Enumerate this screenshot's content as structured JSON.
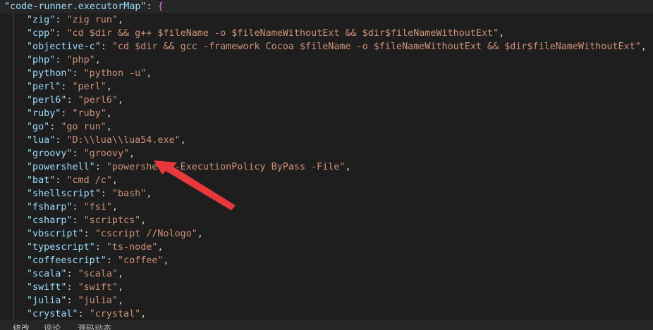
{
  "editor": {
    "header_key": "\"code-runner.executorMap\"",
    "header_colon": ": ",
    "header_brace": "{",
    "entries": [
      {
        "key": "\"zig\"",
        "sep": ": ",
        "value": "\"zig run\"",
        "end": ","
      },
      {
        "key": "\"cpp\"",
        "sep": ": ",
        "value": "\"cd $dir && g++ $fileName -o $fileNameWithoutExt && $dir$fileNameWithoutExt\"",
        "end": ","
      },
      {
        "key": "\"objective-c\"",
        "sep": ": ",
        "value": "\"cd $dir && gcc -framework Cocoa $fileName -o $fileNameWithoutExt && $dir$fileNameWithoutExt\"",
        "end": ","
      },
      {
        "key": "\"php\"",
        "sep": ": ",
        "value": "\"php\"",
        "end": ","
      },
      {
        "key": "\"python\"",
        "sep": ": ",
        "value": "\"python -u\"",
        "end": ","
      },
      {
        "key": "\"perl\"",
        "sep": ": ",
        "value": "\"perl\"",
        "end": ","
      },
      {
        "key": "\"perl6\"",
        "sep": ": ",
        "value": "\"perl6\"",
        "end": ","
      },
      {
        "key": "\"ruby\"",
        "sep": ": ",
        "value": "\"ruby\"",
        "end": ","
      },
      {
        "key": "\"go\"",
        "sep": ": ",
        "value": "\"go run\"",
        "end": ","
      },
      {
        "key": "\"lua\"",
        "sep": ": ",
        "value": "\"D:\\\\lua\\\\lua54.exe\"",
        "end": ","
      },
      {
        "key": "\"groovy\"",
        "sep": ": ",
        "value": "\"groovy\"",
        "end": ","
      },
      {
        "key": "\"powershell\"",
        "sep": ": ",
        "value": "\"powershell -ExecutionPolicy ByPass -File\"",
        "end": ","
      },
      {
        "key": "\"bat\"",
        "sep": ": ",
        "value": "\"cmd /c\"",
        "end": ","
      },
      {
        "key": "\"shellscript\"",
        "sep": ": ",
        "value": "\"bash\"",
        "end": ","
      },
      {
        "key": "\"fsharp\"",
        "sep": ": ",
        "value": "\"fsi\"",
        "end": ","
      },
      {
        "key": "\"csharp\"",
        "sep": ": ",
        "value": "\"scriptcs\"",
        "end": ","
      },
      {
        "key": "\"vbscript\"",
        "sep": ": ",
        "value": "\"cscript //Nologo\"",
        "end": ","
      },
      {
        "key": "\"typescript\"",
        "sep": ": ",
        "value": "\"ts-node\"",
        "end": ","
      },
      {
        "key": "\"coffeescript\"",
        "sep": ": ",
        "value": "\"coffee\"",
        "end": ","
      },
      {
        "key": "\"scala\"",
        "sep": ": ",
        "value": "\"scala\"",
        "end": ","
      },
      {
        "key": "\"swift\"",
        "sep": ": ",
        "value": "\"swift\"",
        "end": ","
      },
      {
        "key": "\"julia\"",
        "sep": ": ",
        "value": "\"julia\"",
        "end": ","
      },
      {
        "key": "\"crystal\"",
        "sep": ": ",
        "value": "\"crystal\"",
        "end": ","
      }
    ]
  },
  "bottom_tabs": [
    "修改",
    "评论",
    "源码动态"
  ],
  "colors": {
    "background": "#1e1e1e",
    "key": "#9cdcfe",
    "string": "#ce9178",
    "brace": "#da70d6",
    "arrow": "#e8383b"
  }
}
